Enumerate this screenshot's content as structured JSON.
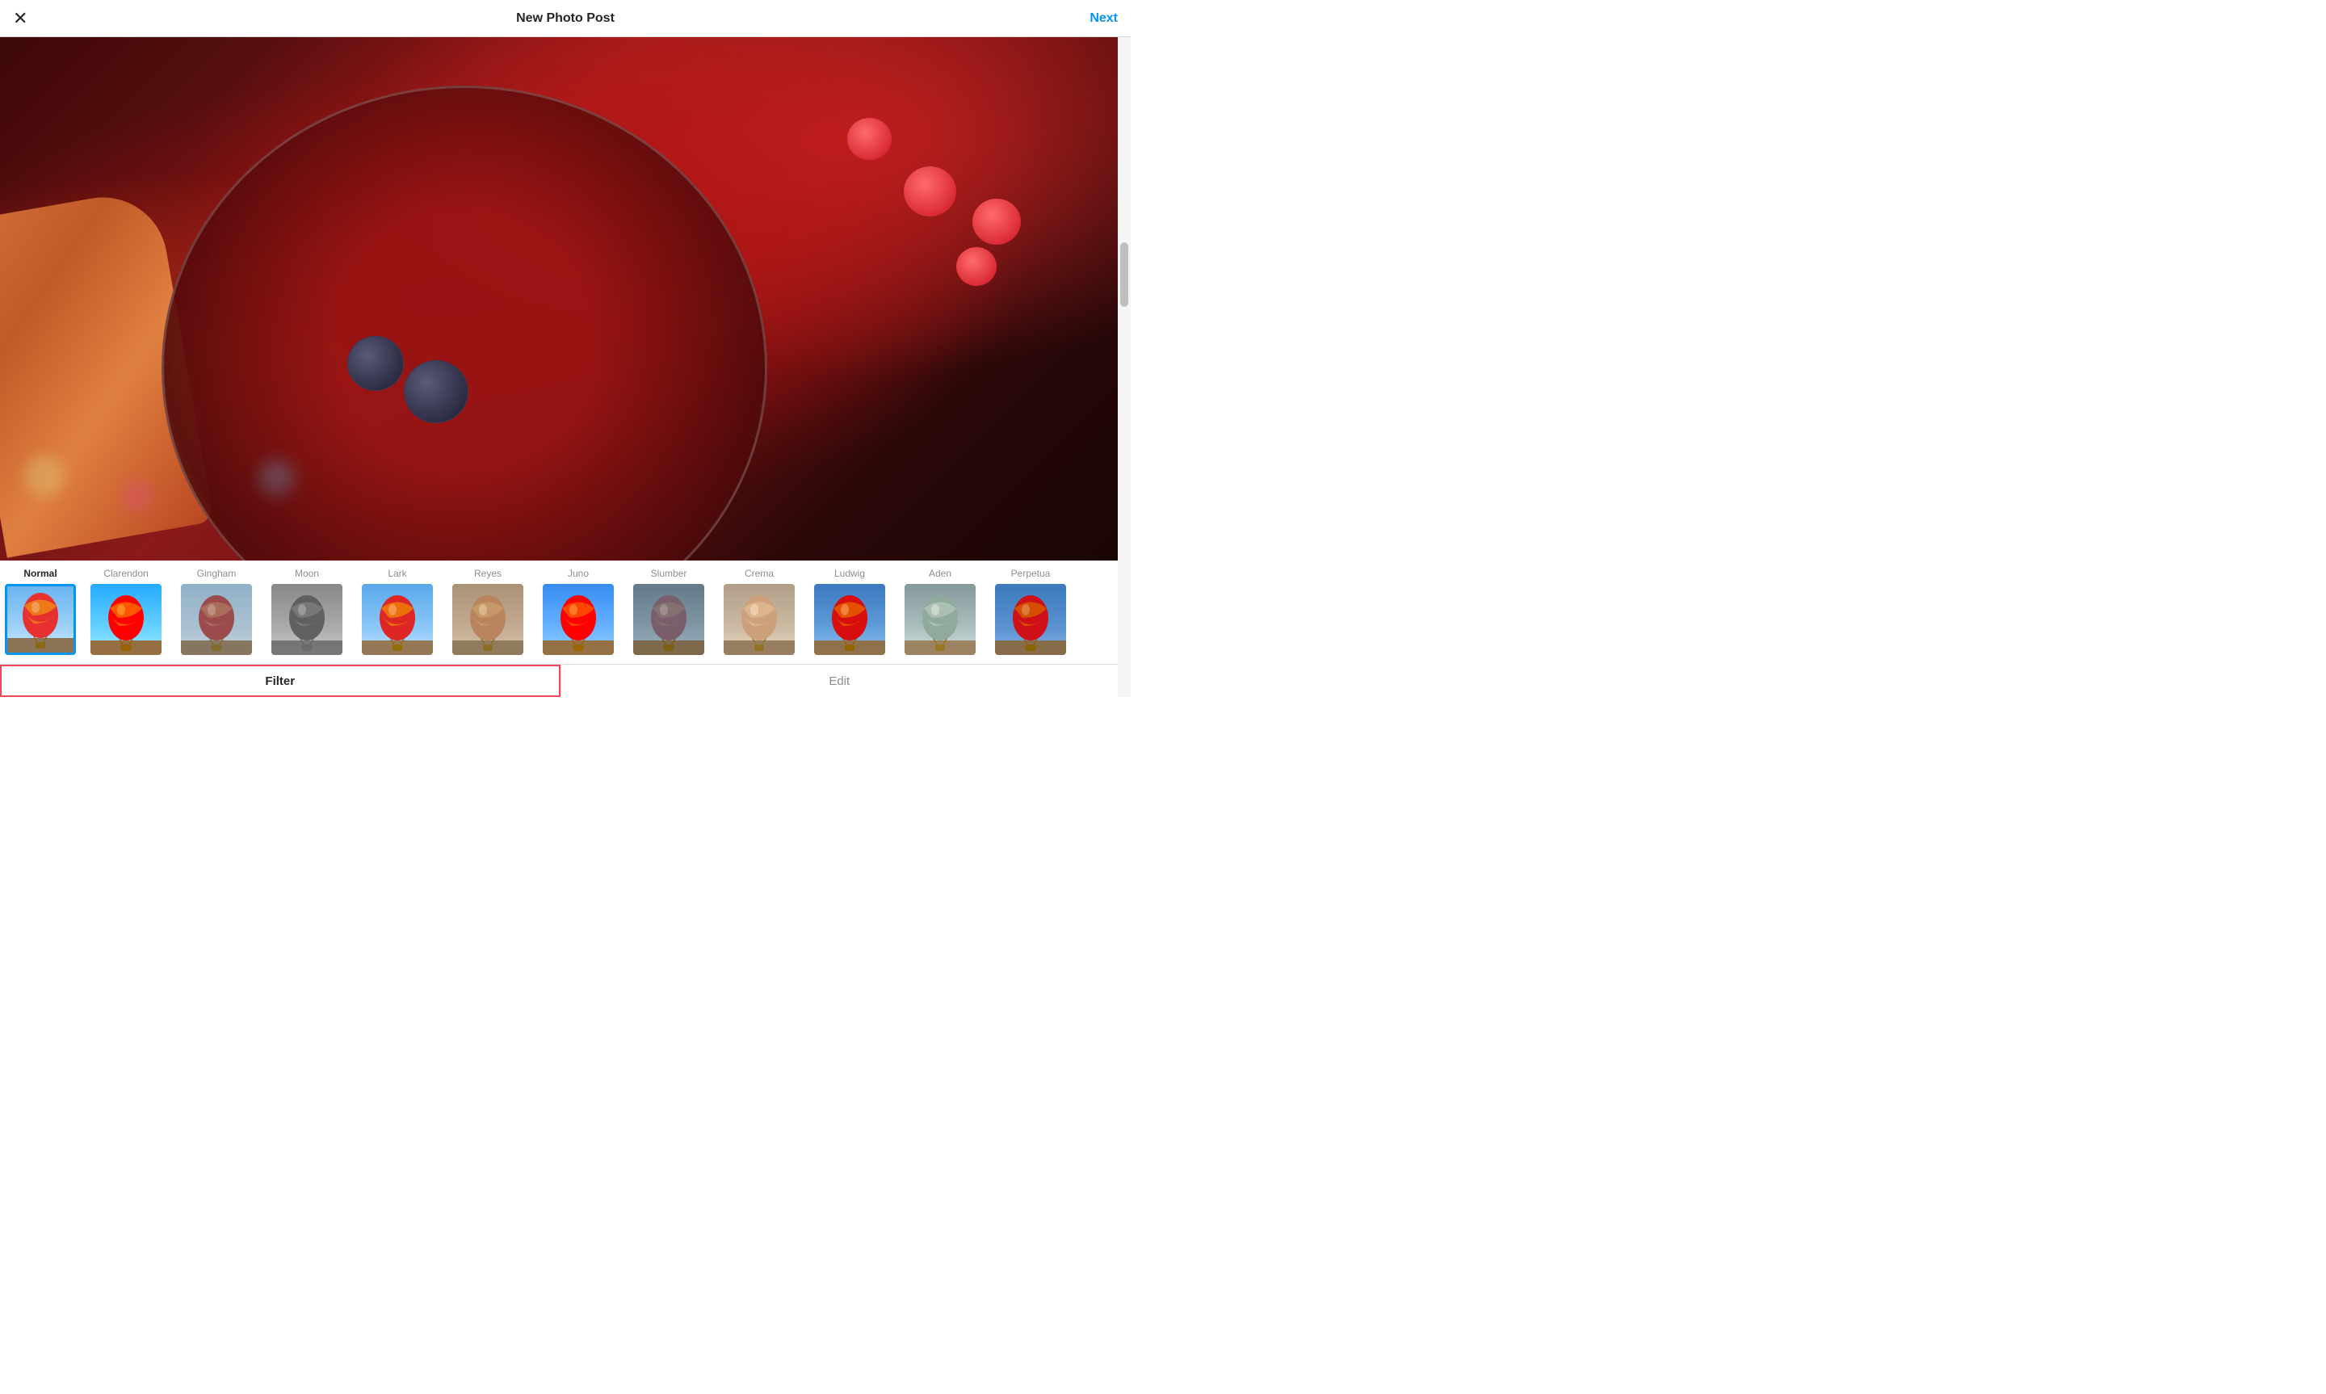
{
  "header": {
    "title": "New Photo Post",
    "close_label": "×",
    "next_label": "Next"
  },
  "filters": [
    {
      "id": "normal",
      "label": "Normal",
      "sky_class": "sky-normal",
      "active": true
    },
    {
      "id": "clarendon",
      "label": "Clarendon",
      "sky_class": "sky-clarendon",
      "active": false
    },
    {
      "id": "gingham",
      "label": "Gingham",
      "sky_class": "sky-gingham",
      "active": false
    },
    {
      "id": "moon",
      "label": "Moon",
      "sky_class": "sky-moon",
      "active": false
    },
    {
      "id": "lark",
      "label": "Lark",
      "sky_class": "sky-lark",
      "active": false
    },
    {
      "id": "reyes",
      "label": "Reyes",
      "sky_class": "sky-reyes",
      "active": false
    },
    {
      "id": "juno",
      "label": "Juno",
      "sky_class": "sky-juno",
      "active": false
    },
    {
      "id": "slumber",
      "label": "Slumber",
      "sky_class": "sky-slumber",
      "active": false
    },
    {
      "id": "crema",
      "label": "Crema",
      "sky_class": "sky-crema",
      "active": false
    },
    {
      "id": "ludwig",
      "label": "Ludwig",
      "sky_class": "sky-ludwig",
      "active": false
    },
    {
      "id": "aden",
      "label": "Aden",
      "sky_class": "sky-aden",
      "active": false
    },
    {
      "id": "perpetua",
      "label": "Perpetua",
      "sky_class": "sky-perpetua",
      "active": false
    }
  ],
  "tabs": {
    "filter_label": "Filter",
    "edit_label": "Edit"
  },
  "accent_color": "#0095f6",
  "highlight_color": "#ed4956"
}
